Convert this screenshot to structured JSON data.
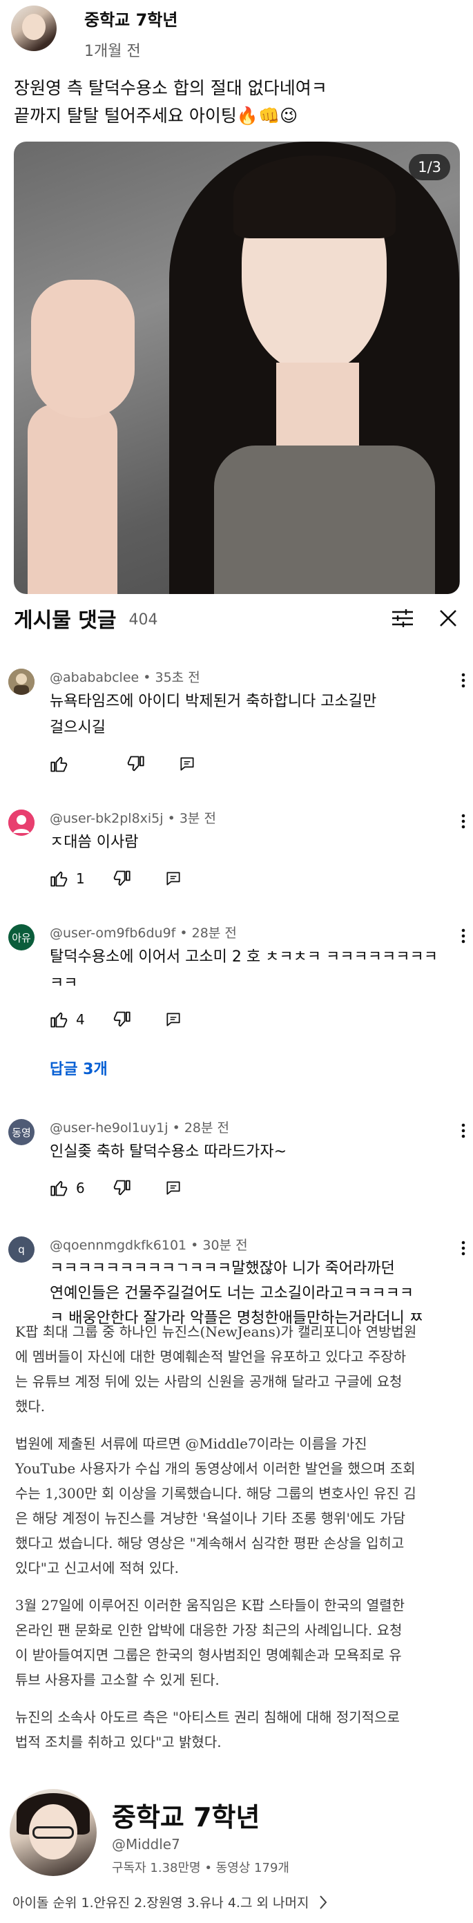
{
  "post": {
    "channel_name": "중학교 7학년",
    "time": "1개월 전",
    "text_lines": [
      "장원영 측 탈덕수용소 합의 절대 없다네여ㅋ",
      "끝까지 탈탈 털어주세요 아이팅🔥👊😉"
    ],
    "image_counter": "1/3"
  },
  "comments_header": {
    "title": "게시물 댓글",
    "count": "404"
  },
  "comments": [
    {
      "author": "@abababclee • 35초 전",
      "lines": [
        "뉴욕타임즈에 아이디 박제된거 축하합니다 고소길만",
        "걸으시길"
      ],
      "likes": "",
      "avatar_color": "#7a6a4f"
    },
    {
      "author": "@user-bk2pl8xi5j • 3분 전",
      "lines": [
        "ㅈ대씀 이사람"
      ],
      "likes": "1",
      "avatar_color": "#e83f6f"
    },
    {
      "author": "@user-om9fb6du9f • 28분 전",
      "lines": [
        "탈덕수용소에 이어서 고소미 2 호 ㅊㅋㅊㅋ ㅋㅋㅋㅋㅋㅋㅋㅋ",
        "ㅋㅋ"
      ],
      "likes": "4",
      "avatar_label": "아유",
      "avatar_color": "#0b5d3b",
      "replies": "답글 3개"
    },
    {
      "author": "@user-he9ol1uy1j • 28분 전",
      "lines": [
        "인실좆 축하 탈덕수용소 따라드가자~"
      ],
      "likes": "6",
      "avatar_label": "동영",
      "avatar_color": "#4f5b75"
    },
    {
      "author": "@qoennmgdkfk6101 • 30분 전",
      "lines": [
        "ㅋㅋㅋㅋㅋㅋㅋㅋㅋㄱㅋㅋㅋ말했잖아 니가 죽어라까던",
        "연예인들은 건물주길걸어도 너는 고소길이라고ㅋㅋㅋㅋㅋ",
        "ㅋ 배웅안한다 잘가라 악플은 명청한애들만하는거라더니 ㅉ"
      ],
      "likes": "",
      "avatar_label": "q",
      "avatar_color": "#47546b"
    }
  ],
  "article": {
    "paragraphs": [
      [
        "K팝 최대 그룹 중 하나인 뉴진스(NewJeans)가 캘리포니아 연방법원",
        "에 멤버들이 자신에 대한 명예훼손적 발언을 유포하고 있다고 주장하",
        "는 유튜브 계정 뒤에 있는 사람의 신원을 공개해 달라고 구글에 요청",
        "했다."
      ],
      [
        "법원에 제출된 서류에 따르면 @Middle7이라는 이름을 가진",
        "YouTube 사용자가 수십 개의 동영상에서 이러한 발언을 했으며 조회",
        "수는 1,300만 회 이상을 기록했습니다. 해당 그룹의 변호사인 유진 김",
        "은 해당 계정이 뉴진스를 겨냥한 '욕설이나 기타 조롱 행위'에도 가담",
        "했다고 썼습니다. 해당 영상은 \"계속해서 심각한 평판 손상을 입히고",
        "있다\"고 신고서에 적혀 있다."
      ],
      [
        "3월 27일에 이루어진 이러한 움직임은 K팝 스타들이 한국의 열렬한",
        "온라인 팬 문화로 인한 압박에 대응한 가장 최근의 사례입니다. 요청",
        "이 받아들여지면 그룹은 한국의 형사범죄인 명예훼손과 모욕죄로 유",
        "튜브 사용자를 고소할 수 있게 된다."
      ],
      [
        "뉴진의 소속사 아도르 측은 \"아티스트 권리 침해에 대해 정기적으로",
        "법적 조치를 취하고 있다\"고 밝혔다."
      ]
    ]
  },
  "channel_card": {
    "name": "중학교 7학년",
    "handle": "@Middle7",
    "stats": "구독자 1.38만명 • 동영상 179개",
    "description": "아이돌 순위 1.안유진 2.장원영 3.유나 4.그 외 나머지"
  }
}
